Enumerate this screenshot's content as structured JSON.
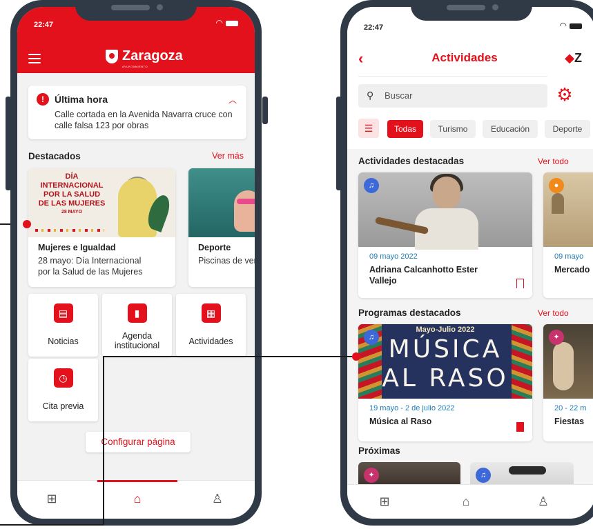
{
  "colors": {
    "brand_red": "#e3111b",
    "frame": "#2f3a46",
    "date_blue": "#1a7db8"
  },
  "left_phone": {
    "status": {
      "time": "22:47"
    },
    "header": {
      "logo_name": "Zaragoza",
      "logo_sub": "AYUNTAMIENTO",
      "menu_icon": "hamburger-icon"
    },
    "alert": {
      "icon": "exclamation-icon",
      "title": "Última hora",
      "text": "Calle cortada en la Avenida Navarra cruce con calle falsa 123 por obras"
    },
    "featured": {
      "title": "Destacados",
      "more": "Ver más",
      "cards": [
        {
          "poster_title": "DÍA INTERNACIONAL\nPOR LA SALUD\nDE LAS MUJERES",
          "poster_date": "28 MAYO",
          "title": "Mujeres e Igualdad",
          "text": "28 mayo: Día Internacional\npor la Salud de las Mujeres"
        },
        {
          "title": "Deporte",
          "text": "Piscinas de verano"
        }
      ]
    },
    "tiles": [
      {
        "label": "Noticias",
        "icon": "newspaper-icon"
      },
      {
        "label": "Agenda\ninstitucional",
        "icon": "book-icon"
      },
      {
        "label": "Actividades",
        "icon": "calendar-icon"
      },
      {
        "label": "Cita previa",
        "icon": "clock-icon"
      }
    ],
    "config_button": "Configurar página",
    "tabbar": {
      "active": "home"
    }
  },
  "right_phone": {
    "status": {
      "time": "22:47"
    },
    "header": {
      "title": "Actividades",
      "logo": "Z"
    },
    "search": {
      "placeholder": "Buscar"
    },
    "filters": [
      "Todas",
      "Turismo",
      "Educación",
      "Deporte"
    ],
    "activities": {
      "title": "Actividades destacadas",
      "more": "Ver todo",
      "cards": [
        {
          "date": "09 mayo 2022",
          "name": "Adriana Calcanhotto Ester\nVallejo",
          "category_icon": "music-note-icon",
          "bookmarked": false
        },
        {
          "date": "09 mayo",
          "name": "Mercado",
          "category_icon": "location-pin-icon"
        }
      ]
    },
    "programs": {
      "title": "Programas destacados",
      "more": "Ver todo",
      "cards": [
        {
          "poster_head": "Mayo-Julio 2022",
          "poster_line1": "MÚSICA",
          "poster_line2": "AL RASO",
          "date": "19 mayo - 2 de julio 2022",
          "name": "Música al Raso",
          "category_icon": "music-note-icon",
          "bookmarked": true
        },
        {
          "date": "20 - 22 m",
          "name": "Fiestas",
          "category_icon": "party-icon"
        }
      ]
    },
    "upcoming": {
      "title": "Próximas"
    }
  }
}
